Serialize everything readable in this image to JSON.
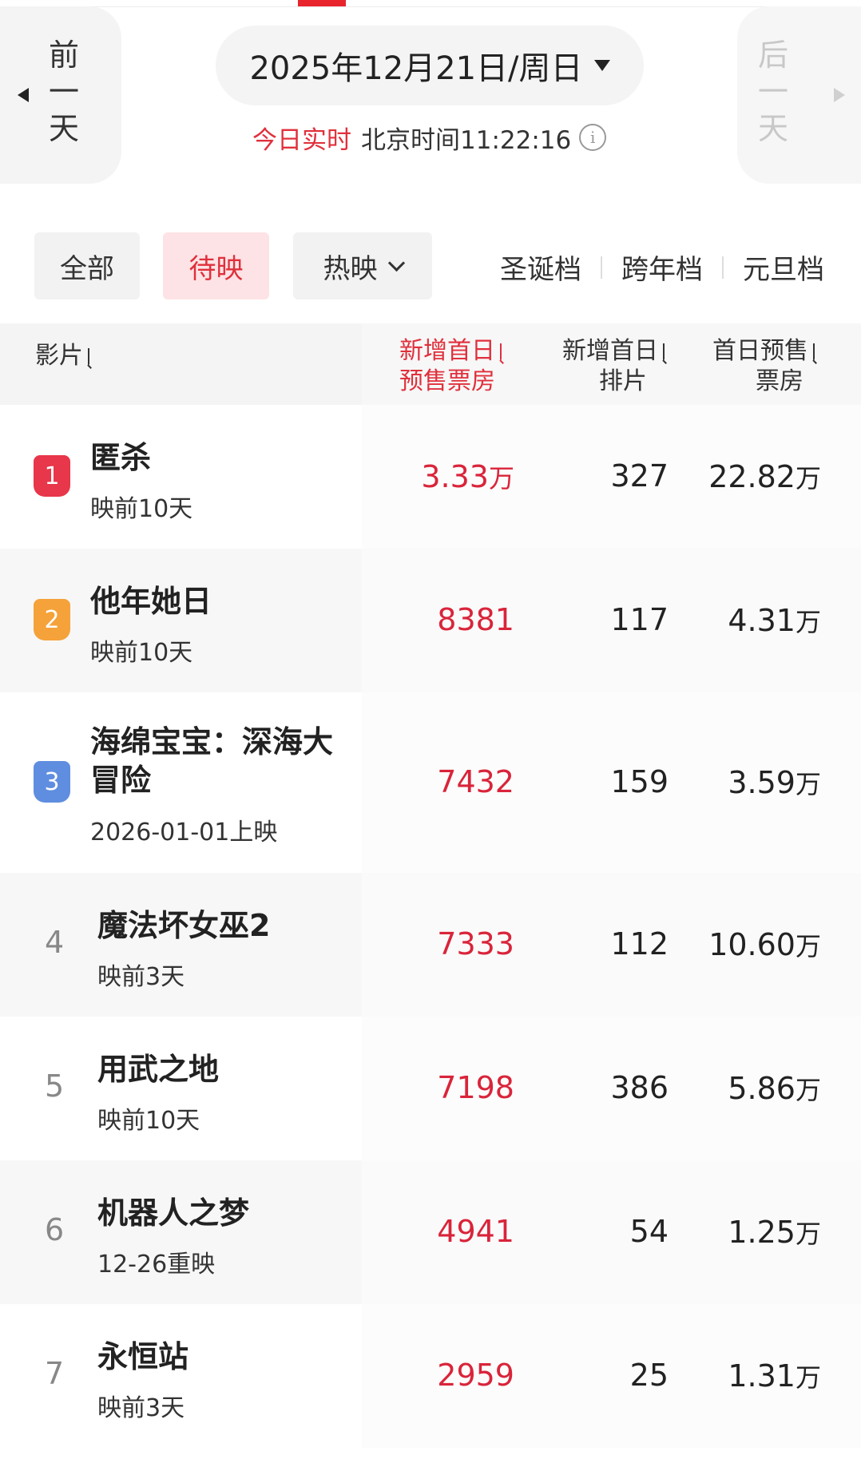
{
  "nav": {
    "prev_chars": [
      "前",
      "一",
      "天"
    ],
    "next_chars": [
      "后",
      "一",
      "天"
    ],
    "date": "2025年12月21日/周日",
    "realtime_label": "今日实时",
    "beijing_time": "北京时间11:22:16",
    "info_icon": "info-icon"
  },
  "filters": {
    "all": "全部",
    "upcoming": "待映",
    "showing": "热映",
    "seasons": [
      "圣诞档",
      "跨年档",
      "元旦档"
    ]
  },
  "table": {
    "headers": {
      "film": "影片",
      "new_presale_l1": "新增首日",
      "new_presale_l2": "预售票房",
      "new_shows_l1": "新增首日",
      "new_shows_l2": "排片",
      "first_presale_l1": "首日预售",
      "first_presale_l2": "票房"
    },
    "rows": [
      {
        "rank": "1",
        "title": "匿杀",
        "sub": "映前10天",
        "new_presale": "3.33",
        "new_presale_unit": "万",
        "new_shows": "327",
        "first_presale": "22.82",
        "first_presale_unit": "万"
      },
      {
        "rank": "2",
        "title": "他年她日",
        "sub": "映前10天",
        "new_presale": "8381",
        "new_presale_unit": "",
        "new_shows": "117",
        "first_presale": "4.31",
        "first_presale_unit": "万"
      },
      {
        "rank": "3",
        "title": "海绵宝宝：深海大冒险",
        "sub": "2026-01-01上映",
        "new_presale": "7432",
        "new_presale_unit": "",
        "new_shows": "159",
        "first_presale": "3.59",
        "first_presale_unit": "万"
      },
      {
        "rank": "4",
        "title": "魔法坏女巫2",
        "sub": "映前3天",
        "new_presale": "7333",
        "new_presale_unit": "",
        "new_shows": "112",
        "first_presale": "10.60",
        "first_presale_unit": "万"
      },
      {
        "rank": "5",
        "title": "用武之地",
        "sub": "映前10天",
        "new_presale": "7198",
        "new_presale_unit": "",
        "new_shows": "386",
        "first_presale": "5.86",
        "first_presale_unit": "万"
      },
      {
        "rank": "6",
        "title": "机器人之梦",
        "sub": "12-26重映",
        "new_presale": "4941",
        "new_presale_unit": "",
        "new_shows": "54",
        "first_presale": "1.25",
        "first_presale_unit": "万"
      },
      {
        "rank": "7",
        "title": "永恒站",
        "sub": "映前3天",
        "new_presale": "2959",
        "new_presale_unit": "",
        "new_shows": "25",
        "first_presale": "1.31",
        "first_presale_unit": "万"
      }
    ]
  },
  "colors": {
    "accent": "#e0303c",
    "badge_1": "#e8364a",
    "badge_2": "#f5a23a",
    "badge_3": "#5f8ee0"
  }
}
